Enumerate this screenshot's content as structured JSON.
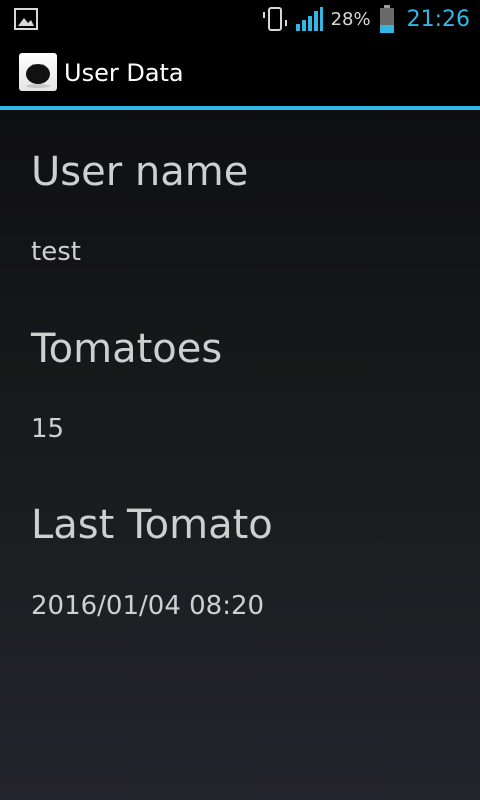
{
  "status_bar": {
    "left_icon": "image-notification-icon",
    "battery_percent": "28%",
    "time": "21:26",
    "accent_color": "#33b5e5"
  },
  "action_bar": {
    "title": "User Data",
    "icon": "tomato-app-icon"
  },
  "fields": [
    {
      "label": "User name",
      "value": "test"
    },
    {
      "label": "Tomatoes",
      "value": "15"
    },
    {
      "label": "Last Tomato",
      "value": "2016/01/04 08:20"
    }
  ]
}
